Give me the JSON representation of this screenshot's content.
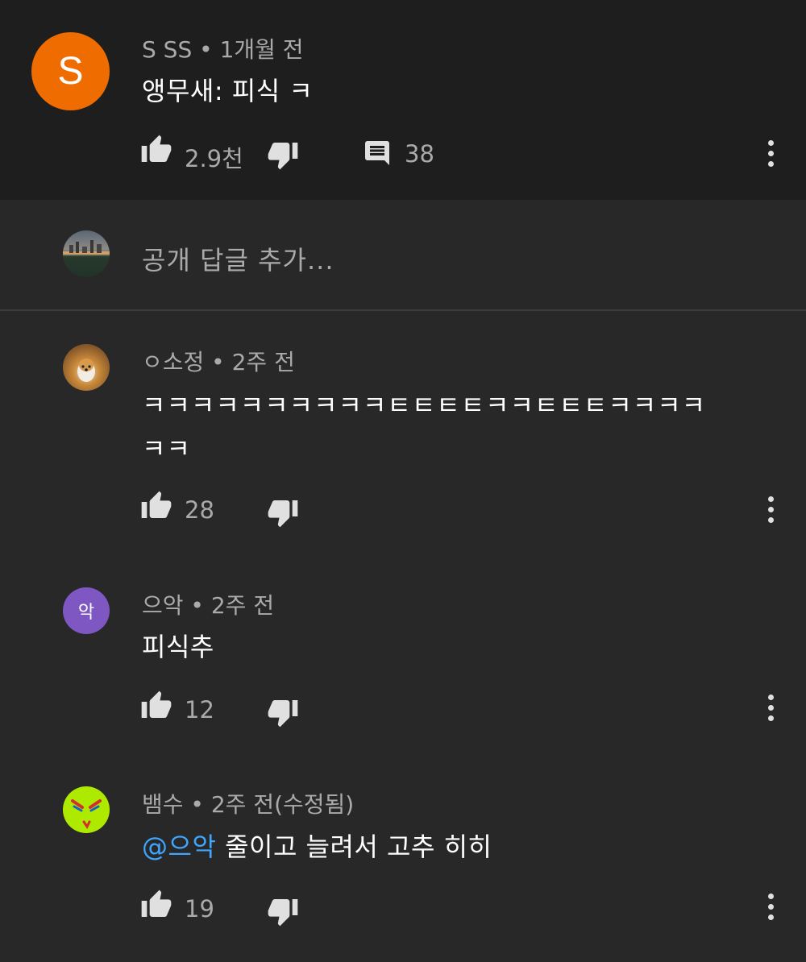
{
  "top_comment": {
    "avatar_letter": "S",
    "author": "S SS",
    "time": "1개월 전",
    "text": "앵무새: 피식 ㅋ",
    "likes": "2.9천",
    "replies": "38",
    "avatar_color": "#ef6c00"
  },
  "reply_input": {
    "placeholder": "공개 답글 추가..."
  },
  "replies": [
    {
      "author": "ㅇ소정",
      "time": "2주 전",
      "text_line1": "ㅋㅋㅋㅋㅋㅋㅋㅋㅋㅋㅌㅌㅌㅌㅋㅋㅌㅌㅌㅋㅋㅋㅋ",
      "text_line2": "ㅋㅋ",
      "likes": "28"
    },
    {
      "avatar_letter": "악",
      "avatar_color": "#7e57c2",
      "author": "으악",
      "time": "2주 전",
      "text": "피식추",
      "likes": "12"
    },
    {
      "author": "뱀수",
      "time": "2주 전(수정됨)",
      "mention": "@으악",
      "text": " 줄이고 늘려서 고추 히히",
      "likes": "19",
      "avatar_color": "#aeea00"
    }
  ],
  "separator": " • ",
  "colors": {
    "background": "#282828",
    "top_background": "#1e1e1e",
    "mention": "#3ea6ff",
    "secondary_text": "#aaaaaa"
  }
}
